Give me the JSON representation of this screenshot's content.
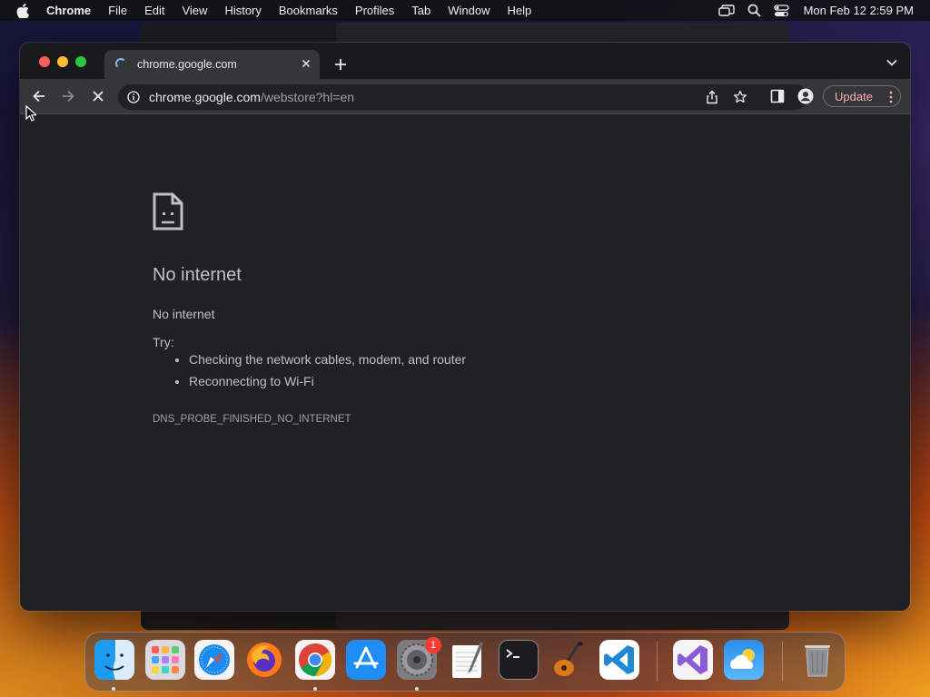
{
  "menubar": {
    "app_name": "Chrome",
    "items": [
      "File",
      "Edit",
      "View",
      "History",
      "Bookmarks",
      "Profiles",
      "Tab",
      "Window",
      "Help"
    ],
    "clock": "Mon Feb 12  2:59 PM",
    "status_icons": [
      "screen-mirroring-icon",
      "spotlight-search-icon",
      "control-center-icon"
    ]
  },
  "browser": {
    "tab": {
      "title": "chrome.google.com",
      "loading": true
    },
    "address": {
      "host": "chrome.google.com",
      "path": "/webstore?hl=en"
    },
    "update_label": "Update"
  },
  "error_page": {
    "title": "No internet",
    "subtitle": "No internet",
    "try_label": "Try:",
    "suggestions": [
      "Checking the network cables, modem, and router",
      "Reconnecting to Wi-Fi"
    ],
    "code": "DNS_PROBE_FINISHED_NO_INTERNET"
  },
  "dock": {
    "apps": [
      {
        "name": "Finder",
        "icon": "finder-icon",
        "running": true
      },
      {
        "name": "Launchpad",
        "icon": "launchpad-icon",
        "running": false
      },
      {
        "name": "Safari",
        "icon": "safari-icon",
        "running": false
      },
      {
        "name": "Firefox",
        "icon": "firefox-icon",
        "running": false
      },
      {
        "name": "Google Chrome",
        "icon": "chrome-icon",
        "running": true
      },
      {
        "name": "App Store",
        "icon": "app-store-icon",
        "running": false
      },
      {
        "name": "System Settings",
        "icon": "system-settings-icon",
        "running": true,
        "badge": "1"
      },
      {
        "name": "TextEdit",
        "icon": "textedit-icon",
        "running": false
      },
      {
        "name": "Terminal",
        "icon": "terminal-icon",
        "running": false
      },
      {
        "name": "GarageBand",
        "icon": "garageband-icon",
        "running": false
      },
      {
        "name": "Visual Studio Code",
        "icon": "vscode-icon",
        "running": false
      },
      {
        "name": "Visual Studio",
        "icon": "visual-studio-icon",
        "running": false
      },
      {
        "name": "Weather",
        "icon": "weather-icon",
        "running": false
      },
      {
        "name": "Trash",
        "icon": "trash-icon",
        "running": false
      }
    ]
  },
  "colors": {
    "window_bg": "#202124",
    "toolbar_bg": "#35363a",
    "update_text": "#f6aea9",
    "text": "#bdc1c6"
  }
}
